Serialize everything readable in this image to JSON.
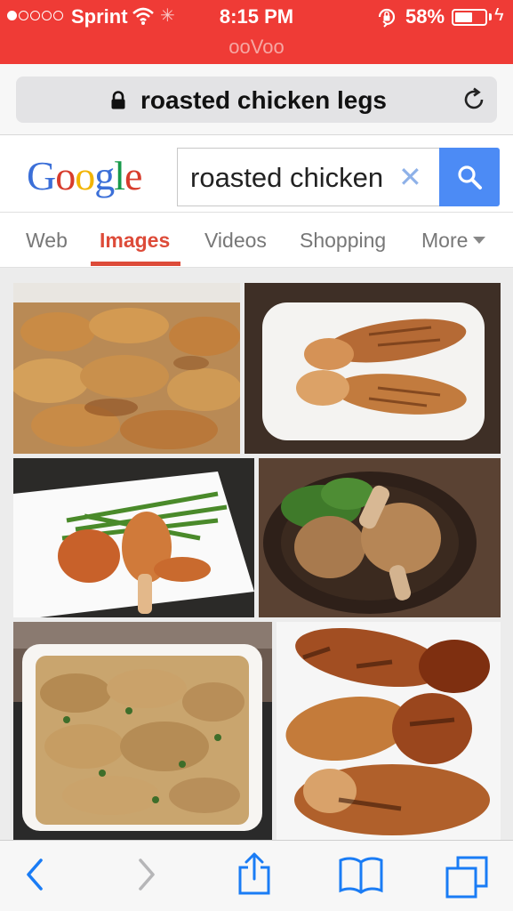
{
  "status_bar": {
    "carrier": "Sprint",
    "time": "8:15 PM",
    "battery_percent": "58%",
    "battery_level": 0.58,
    "signal_bars_filled": 1,
    "signal_bars_total": 5,
    "app_label": "ooVoo",
    "background_color": "#ef3b36"
  },
  "address_bar": {
    "text": "roasted chicken legs",
    "lock_icon": "lock-icon",
    "reload_icon": "reload-icon"
  },
  "google": {
    "logo_letters": [
      "G",
      "o",
      "o",
      "g",
      "l",
      "e"
    ],
    "logo_colors": [
      "#3b6fd8",
      "#d73c2c",
      "#f2b400",
      "#3b6fd8",
      "#189a4b",
      "#d73c2c"
    ],
    "search_value": "roasted chicken",
    "clear_icon": "close-icon",
    "search_button_icon": "search-icon",
    "accent_color": "#4c8bf5"
  },
  "tabs": [
    {
      "label": "Web",
      "active": false
    },
    {
      "label": "Images",
      "active": true
    },
    {
      "label": "Videos",
      "active": false
    },
    {
      "label": "Shopping",
      "active": false
    },
    {
      "label": "More",
      "active": false
    }
  ],
  "results": {
    "images": [
      {
        "subject": "roasted chicken drumsticks on tray"
      },
      {
        "subject": "two grilled drumsticks on white plate"
      },
      {
        "subject": "drumsticks with green beans"
      },
      {
        "subject": "breaded drumsticks with salad"
      },
      {
        "subject": "herb roasted drumsticks in dish"
      },
      {
        "subject": "charred glazed drumsticks"
      }
    ]
  },
  "toolbar": {
    "back_icon": "back-chevron-icon",
    "forward_icon": "forward-chevron-icon",
    "share_icon": "share-icon",
    "bookmarks_icon": "bookmarks-icon",
    "tabs_icon": "tabs-icon",
    "tint_color": "#1a7cf5"
  }
}
